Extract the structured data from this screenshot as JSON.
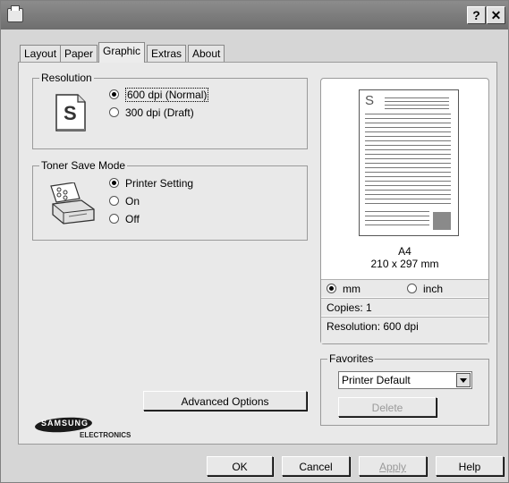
{
  "window": {
    "help_glyph": "?",
    "close_glyph": "✕"
  },
  "tabs": [
    {
      "label": "Layout"
    },
    {
      "label": "Paper"
    },
    {
      "label": "Graphic",
      "active": true
    },
    {
      "label": "Extras"
    },
    {
      "label": "About"
    }
  ],
  "resolution": {
    "title": "Resolution",
    "icon_letter": "S",
    "options": [
      {
        "label": "600 dpi (Normal)",
        "selected": true
      },
      {
        "label": "300 dpi (Draft)",
        "selected": false
      }
    ]
  },
  "toner": {
    "title": "Toner Save Mode",
    "options": [
      {
        "label": "Printer Setting",
        "selected": true
      },
      {
        "label": "On",
        "selected": false
      },
      {
        "label": "Off",
        "selected": false
      }
    ]
  },
  "advanced_button": "Advanced Options",
  "preview": {
    "page_letter": "S",
    "paper_name": "A4",
    "paper_size": "210 x 297 mm",
    "unit_mm": "mm",
    "unit_inch": "inch",
    "unit_selected": "mm",
    "copies": "Copies: 1",
    "resolution": "Resolution: 600 dpi"
  },
  "favorites": {
    "title": "Favorites",
    "selected": "Printer Default",
    "delete_label": "Delete"
  },
  "logo": {
    "brand": "SAMSUNG",
    "sub": "ELECTRONICS"
  },
  "footer": {
    "ok": "OK",
    "cancel": "Cancel",
    "apply": "Apply",
    "help": "Help"
  }
}
